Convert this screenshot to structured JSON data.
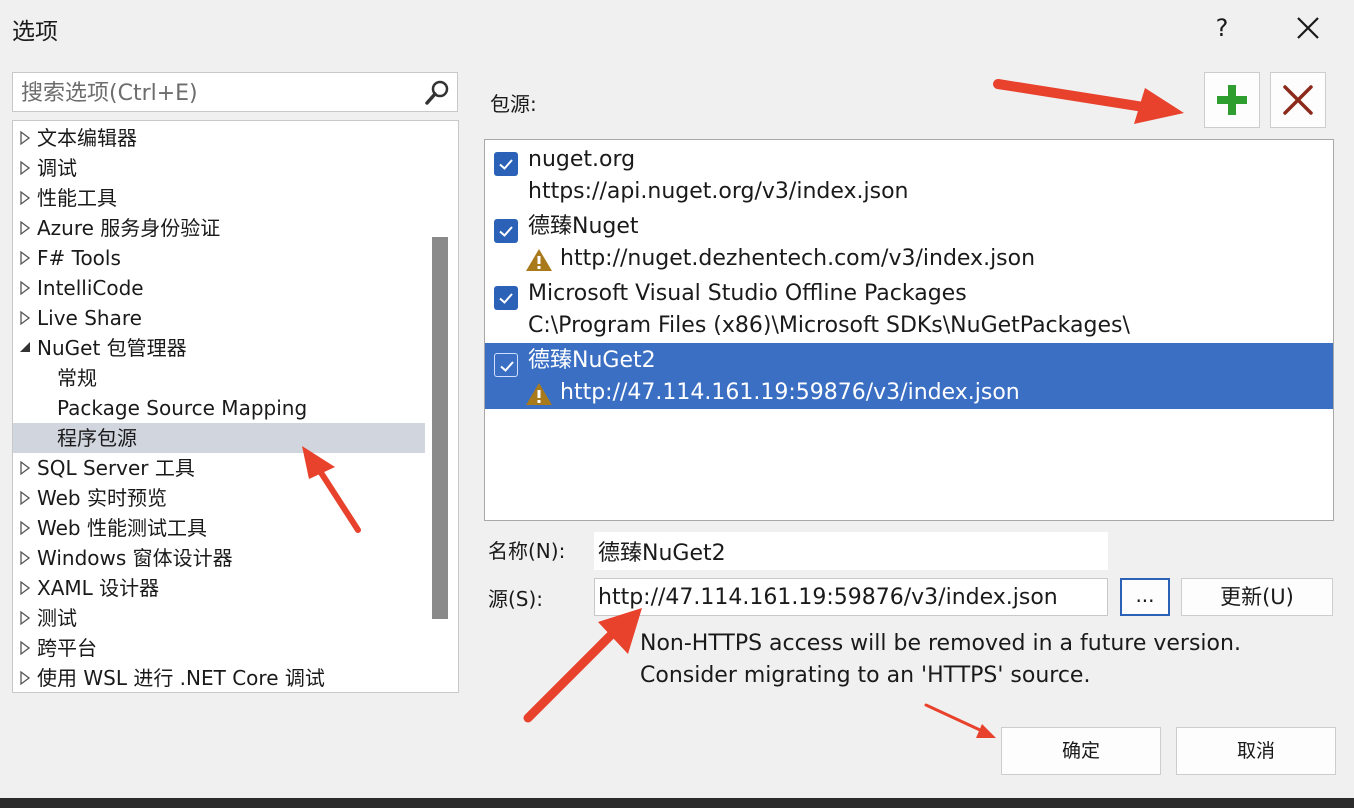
{
  "window": {
    "title": "选项",
    "help": "?"
  },
  "search": {
    "placeholder": "搜索选项(Ctrl+E)"
  },
  "tree": {
    "items": [
      {
        "label": "文本编辑器",
        "arrow": "collapsed"
      },
      {
        "label": "调试",
        "arrow": "collapsed"
      },
      {
        "label": "性能工具",
        "arrow": "collapsed"
      },
      {
        "label": "Azure 服务身份验证",
        "arrow": "collapsed"
      },
      {
        "label": "F# Tools",
        "arrow": "collapsed"
      },
      {
        "label": "IntelliCode",
        "arrow": "collapsed"
      },
      {
        "label": "Live Share",
        "arrow": "collapsed"
      },
      {
        "label": "NuGet 包管理器",
        "arrow": "expanded"
      },
      {
        "label": "常规",
        "arrow": "none"
      },
      {
        "label": "Package Source Mapping",
        "arrow": "none"
      },
      {
        "label": "程序包源",
        "arrow": "none",
        "selected": true
      },
      {
        "label": "SQL Server 工具",
        "arrow": "collapsed"
      },
      {
        "label": "Web 实时预览",
        "arrow": "collapsed"
      },
      {
        "label": "Web 性能测试工具",
        "arrow": "collapsed"
      },
      {
        "label": "Windows 窗体设计器",
        "arrow": "collapsed"
      },
      {
        "label": "XAML 设计器",
        "arrow": "collapsed"
      },
      {
        "label": "测试",
        "arrow": "collapsed"
      },
      {
        "label": "跨平台",
        "arrow": "collapsed"
      },
      {
        "label": "使用 WSL 进行 .NET Core 调试",
        "arrow": "collapsed"
      }
    ]
  },
  "sources": {
    "label": "包源:",
    "items": [
      {
        "name": "nuget.org",
        "url": "https://api.nuget.org/v3/index.json",
        "checked": true,
        "warning": false
      },
      {
        "name": "德臻Nuget",
        "url": "http://nuget.dezhentech.com/v3/index.json",
        "checked": true,
        "warning": true
      },
      {
        "name": "Microsoft Visual Studio Offline Packages",
        "url": "C:\\Program Files (x86)\\Microsoft SDKs\\NuGetPackages\\",
        "checked": true,
        "warning": false
      },
      {
        "name": "德臻NuGet2",
        "url": "http://47.114.161.19:59876/v3/index.json",
        "checked": true,
        "warning": true,
        "selected": true
      }
    ]
  },
  "form": {
    "name_label": "名称(N):",
    "name_value": "德臻NuGet2",
    "source_label": "源(S):",
    "source_value": "http://47.114.161.19:59876/v3/index.json",
    "browse_label": "...",
    "update_label": "更新(U)",
    "warning_line1": "Non-HTTPS access will be removed in a future version.",
    "warning_line2": "Consider migrating to an 'HTTPS' source."
  },
  "footer": {
    "ok_label": "确定",
    "cancel_label": "取消"
  },
  "colors": {
    "accent": "#2b62b8",
    "selection": "#3a6fc4",
    "annotation": "#e8412c",
    "add_icon": "#2e9e2e",
    "remove_icon": "#8b2a1a"
  }
}
